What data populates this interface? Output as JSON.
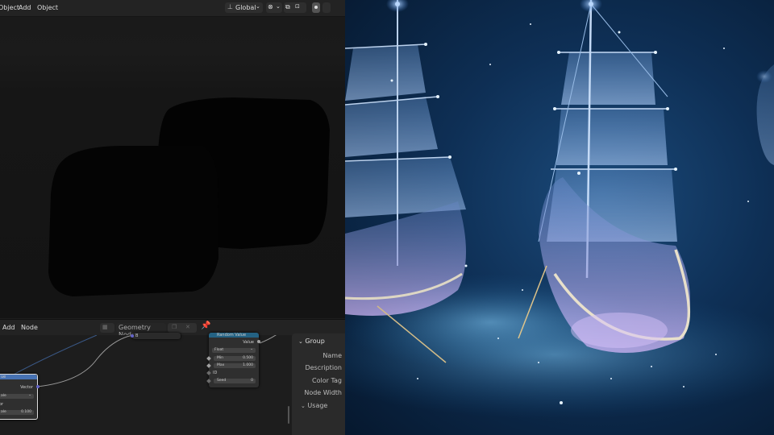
{
  "viewport_header": {
    "menu": [
      "Object",
      "Add",
      "Object"
    ],
    "transform_orientation": "Global"
  },
  "node_editor_header": {
    "menu": [
      "Add",
      "Node"
    ],
    "tree_name": "Geometry Nodes"
  },
  "nodes": {
    "random_value": {
      "title": "Random Value",
      "output_label": "Value",
      "data_type": "Float",
      "min_label": "Min",
      "min_value": "0.500",
      "max_label": "Max",
      "max_value": "1.000",
      "id_label": "ID",
      "seed_label": "Seed",
      "seed_value": "0"
    },
    "left_node": {
      "header_fragment": "ue",
      "output_label": "Vector",
      "row1_fragment": "ale",
      "row2_fragment": "or",
      "scale_fragment": "ale",
      "scale_value": "0.100"
    },
    "input_socket_fragment": "B"
  },
  "group_panel": {
    "section_title": "Group",
    "rows": [
      "Name",
      "Description",
      "Color Tag",
      "Node Width"
    ],
    "usage_title": "Usage"
  },
  "colors": {
    "accent_blue": "#4772b3",
    "node_header_teal": "#246283",
    "link_gray": "#9a9a9a",
    "scene_blue": "#0e2f55"
  }
}
